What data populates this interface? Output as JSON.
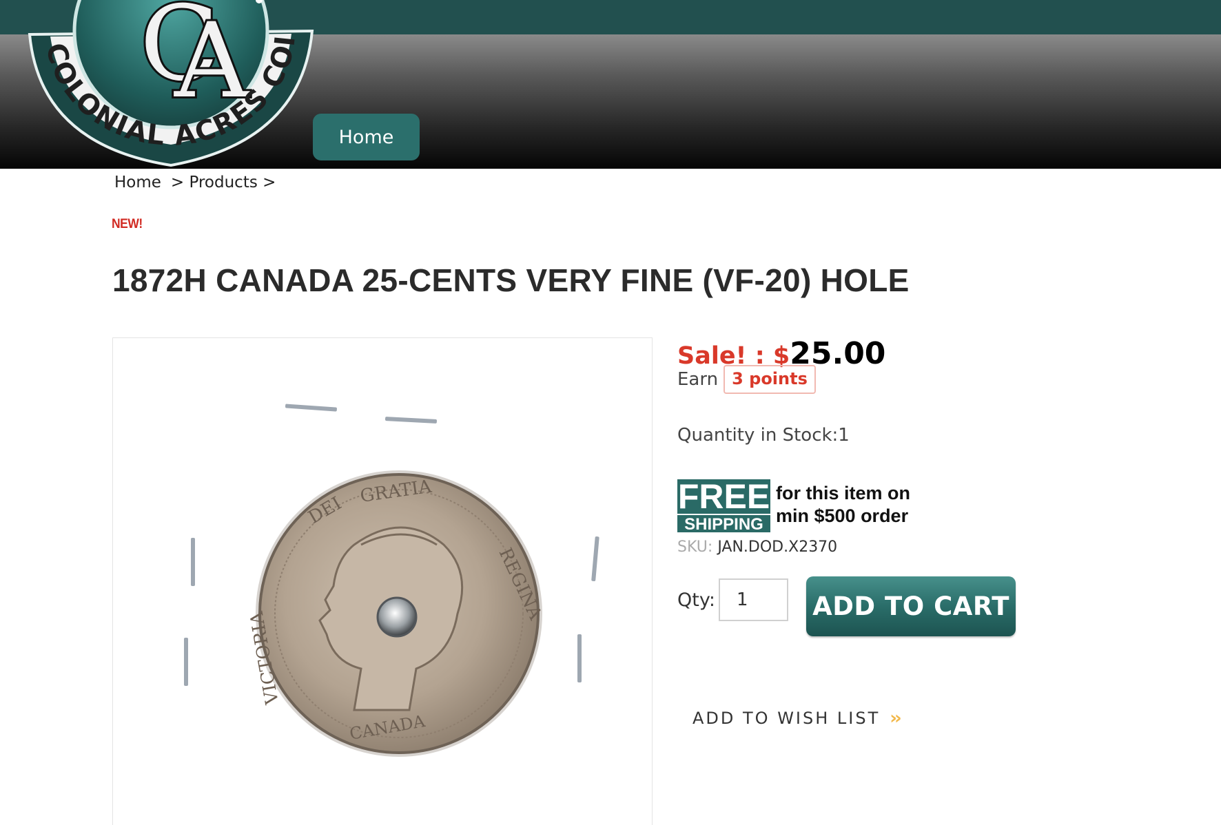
{
  "header": {
    "logo_initials": "CA",
    "logo_text": "COLONIAL ACRES COINS",
    "nav": {
      "home_label": "Home"
    }
  },
  "breadcrumb": {
    "home": "Home",
    "products": "> Products >",
    "sep": ">"
  },
  "product": {
    "badge": "NEW!",
    "title": "1872H CANADA 25-CENTS VERY FINE (VF-20) HOLE",
    "sale_prefix": "Sale! : $",
    "price": "25.00",
    "earn_label": "Earn",
    "points": "3 points",
    "stock": "Quantity in Stock:1",
    "free_shipping": {
      "free": "FREE",
      "shipping": "SHIPPING",
      "line1": "for this item on",
      "line2": "min $500 order"
    },
    "sku_label": "SKU:",
    "sku": "JAN.DOD.X2370",
    "qty_label": "Qty:",
    "qty_value": "1",
    "add_to_cart": "ADD TO CART",
    "wishlist": "ADD TO WISH LIST",
    "coin_legend": {
      "top": "DEI GRATIA",
      "right": "REGINA",
      "left": "VICTORIA",
      "bottom": "CANADA"
    }
  },
  "colors": {
    "brand_teal": "#2a6a66",
    "sale_red": "#d9392a",
    "accent_gold": "#f2b84a"
  }
}
